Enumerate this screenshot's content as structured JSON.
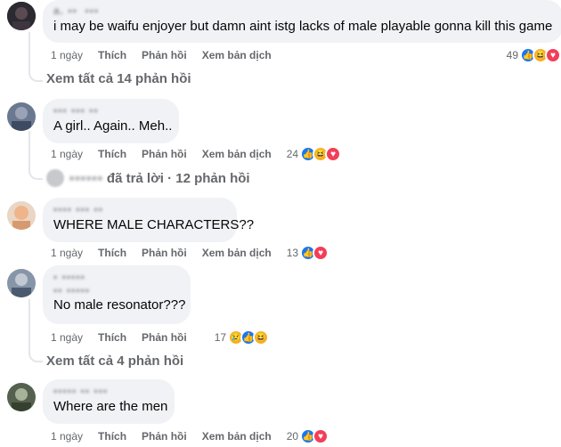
{
  "comments": [
    {
      "text": "i may be waifu enjoyer but damn aint istg lacks of male playable gonna kill this game",
      "time": "1 ngày",
      "like_label": "Thích",
      "reply_label": "Phản hồi",
      "translate_label": "Xem bản dịch",
      "reaction_count": "49",
      "reactions": [
        "like",
        "haha",
        "love"
      ],
      "view_replies": "Xem tất cả 14 phản hồi"
    },
    {
      "text": "A girl.. Again.. Meh..",
      "time": "1 ngày",
      "like_label": "Thích",
      "reply_label": "Phản hồi",
      "translate_label": "Xem bản dịch",
      "reaction_count": "24",
      "reactions": [
        "like",
        "haha",
        "love"
      ],
      "replied_summary": "đã trả lời · 12 phản hồi"
    },
    {
      "text": "WHERE MALE CHARACTERS??",
      "time": "1 ngày",
      "like_label": "Thích",
      "reply_label": "Phản hồi",
      "translate_label": "Xem bản dịch",
      "reaction_count": "13",
      "reactions": [
        "like",
        "love"
      ]
    },
    {
      "text": "No male resonator???",
      "time": "1 ngày",
      "like_label": "Thích",
      "reply_label": "Phản hồi",
      "reaction_count": "17",
      "reactions": [
        "sad",
        "like",
        "haha"
      ],
      "view_replies": "Xem tất cả 4 phản hồi"
    },
    {
      "text": "Where are the men",
      "time": "1 ngày",
      "like_label": "Thích",
      "reply_label": "Phản hồi",
      "translate_label": "Xem bản dịch",
      "reaction_count": "20",
      "reactions": [
        "like",
        "love"
      ]
    }
  ],
  "colors": {
    "bubble": "#f0f2f5",
    "like": "#1877f2",
    "love": "#f33e58",
    "haha": "#f7b125",
    "meta": "#65676b"
  }
}
